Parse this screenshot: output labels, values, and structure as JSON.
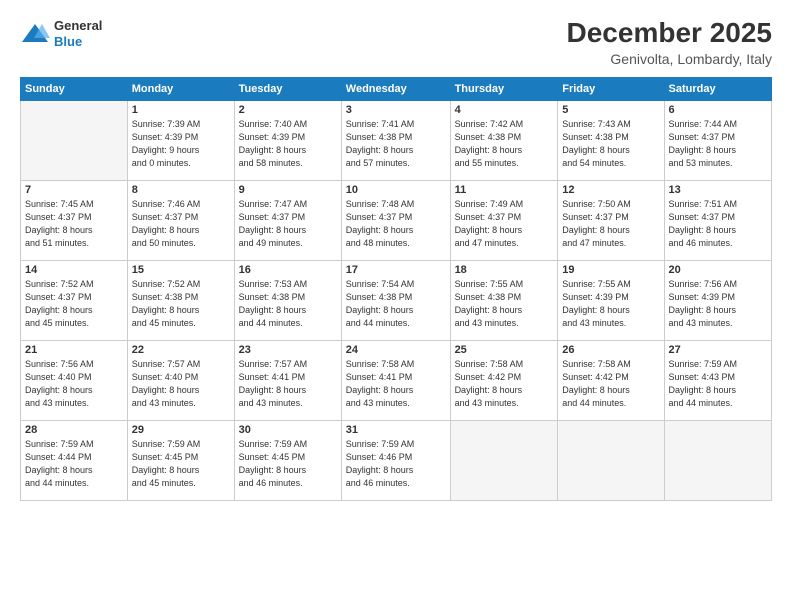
{
  "logo": {
    "line1": "General",
    "line2": "Blue"
  },
  "title": "December 2025",
  "location": "Genivolta, Lombardy, Italy",
  "headers": [
    "Sunday",
    "Monday",
    "Tuesday",
    "Wednesday",
    "Thursday",
    "Friday",
    "Saturday"
  ],
  "weeks": [
    [
      {
        "day": "",
        "info": ""
      },
      {
        "day": "1",
        "info": "Sunrise: 7:39 AM\nSunset: 4:39 PM\nDaylight: 9 hours\nand 0 minutes."
      },
      {
        "day": "2",
        "info": "Sunrise: 7:40 AM\nSunset: 4:39 PM\nDaylight: 8 hours\nand 58 minutes."
      },
      {
        "day": "3",
        "info": "Sunrise: 7:41 AM\nSunset: 4:38 PM\nDaylight: 8 hours\nand 57 minutes."
      },
      {
        "day": "4",
        "info": "Sunrise: 7:42 AM\nSunset: 4:38 PM\nDaylight: 8 hours\nand 55 minutes."
      },
      {
        "day": "5",
        "info": "Sunrise: 7:43 AM\nSunset: 4:38 PM\nDaylight: 8 hours\nand 54 minutes."
      },
      {
        "day": "6",
        "info": "Sunrise: 7:44 AM\nSunset: 4:37 PM\nDaylight: 8 hours\nand 53 minutes."
      }
    ],
    [
      {
        "day": "7",
        "info": "Sunrise: 7:45 AM\nSunset: 4:37 PM\nDaylight: 8 hours\nand 51 minutes."
      },
      {
        "day": "8",
        "info": "Sunrise: 7:46 AM\nSunset: 4:37 PM\nDaylight: 8 hours\nand 50 minutes."
      },
      {
        "day": "9",
        "info": "Sunrise: 7:47 AM\nSunset: 4:37 PM\nDaylight: 8 hours\nand 49 minutes."
      },
      {
        "day": "10",
        "info": "Sunrise: 7:48 AM\nSunset: 4:37 PM\nDaylight: 8 hours\nand 48 minutes."
      },
      {
        "day": "11",
        "info": "Sunrise: 7:49 AM\nSunset: 4:37 PM\nDaylight: 8 hours\nand 47 minutes."
      },
      {
        "day": "12",
        "info": "Sunrise: 7:50 AM\nSunset: 4:37 PM\nDaylight: 8 hours\nand 47 minutes."
      },
      {
        "day": "13",
        "info": "Sunrise: 7:51 AM\nSunset: 4:37 PM\nDaylight: 8 hours\nand 46 minutes."
      }
    ],
    [
      {
        "day": "14",
        "info": "Sunrise: 7:52 AM\nSunset: 4:37 PM\nDaylight: 8 hours\nand 45 minutes."
      },
      {
        "day": "15",
        "info": "Sunrise: 7:52 AM\nSunset: 4:38 PM\nDaylight: 8 hours\nand 45 minutes."
      },
      {
        "day": "16",
        "info": "Sunrise: 7:53 AM\nSunset: 4:38 PM\nDaylight: 8 hours\nand 44 minutes."
      },
      {
        "day": "17",
        "info": "Sunrise: 7:54 AM\nSunset: 4:38 PM\nDaylight: 8 hours\nand 44 minutes."
      },
      {
        "day": "18",
        "info": "Sunrise: 7:55 AM\nSunset: 4:38 PM\nDaylight: 8 hours\nand 43 minutes."
      },
      {
        "day": "19",
        "info": "Sunrise: 7:55 AM\nSunset: 4:39 PM\nDaylight: 8 hours\nand 43 minutes."
      },
      {
        "day": "20",
        "info": "Sunrise: 7:56 AM\nSunset: 4:39 PM\nDaylight: 8 hours\nand 43 minutes."
      }
    ],
    [
      {
        "day": "21",
        "info": "Sunrise: 7:56 AM\nSunset: 4:40 PM\nDaylight: 8 hours\nand 43 minutes."
      },
      {
        "day": "22",
        "info": "Sunrise: 7:57 AM\nSunset: 4:40 PM\nDaylight: 8 hours\nand 43 minutes."
      },
      {
        "day": "23",
        "info": "Sunrise: 7:57 AM\nSunset: 4:41 PM\nDaylight: 8 hours\nand 43 minutes."
      },
      {
        "day": "24",
        "info": "Sunrise: 7:58 AM\nSunset: 4:41 PM\nDaylight: 8 hours\nand 43 minutes."
      },
      {
        "day": "25",
        "info": "Sunrise: 7:58 AM\nSunset: 4:42 PM\nDaylight: 8 hours\nand 43 minutes."
      },
      {
        "day": "26",
        "info": "Sunrise: 7:58 AM\nSunset: 4:42 PM\nDaylight: 8 hours\nand 44 minutes."
      },
      {
        "day": "27",
        "info": "Sunrise: 7:59 AM\nSunset: 4:43 PM\nDaylight: 8 hours\nand 44 minutes."
      }
    ],
    [
      {
        "day": "28",
        "info": "Sunrise: 7:59 AM\nSunset: 4:44 PM\nDaylight: 8 hours\nand 44 minutes."
      },
      {
        "day": "29",
        "info": "Sunrise: 7:59 AM\nSunset: 4:45 PM\nDaylight: 8 hours\nand 45 minutes."
      },
      {
        "day": "30",
        "info": "Sunrise: 7:59 AM\nSunset: 4:45 PM\nDaylight: 8 hours\nand 46 minutes."
      },
      {
        "day": "31",
        "info": "Sunrise: 7:59 AM\nSunset: 4:46 PM\nDaylight: 8 hours\nand 46 minutes."
      },
      {
        "day": "",
        "info": ""
      },
      {
        "day": "",
        "info": ""
      },
      {
        "day": "",
        "info": ""
      }
    ]
  ]
}
